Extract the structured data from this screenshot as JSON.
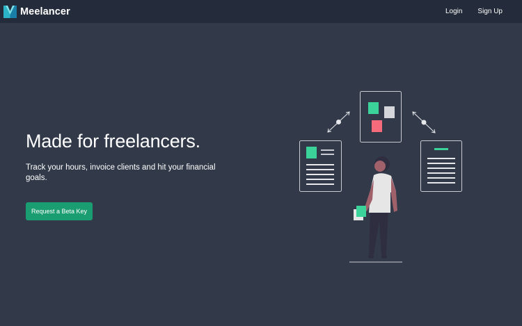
{
  "navbar": {
    "brand": {
      "name": "Meelancer",
      "logo_icon": "meelancer-m-logo"
    },
    "links": [
      {
        "label": "Login"
      },
      {
        "label": "Sign Up"
      }
    ]
  },
  "hero": {
    "title": "Made for freelancers.",
    "subtitle": "Track your hours, invoice clients and hit your financial goals.",
    "cta_label": "Request a Beta Key"
  },
  "colors": {
    "page_bg": "#323a4a",
    "navbar_bg": "#242b3a",
    "accent": "#1b9d72",
    "illustration_green": "#3bd39a",
    "illustration_pink": "#f56b7c"
  }
}
